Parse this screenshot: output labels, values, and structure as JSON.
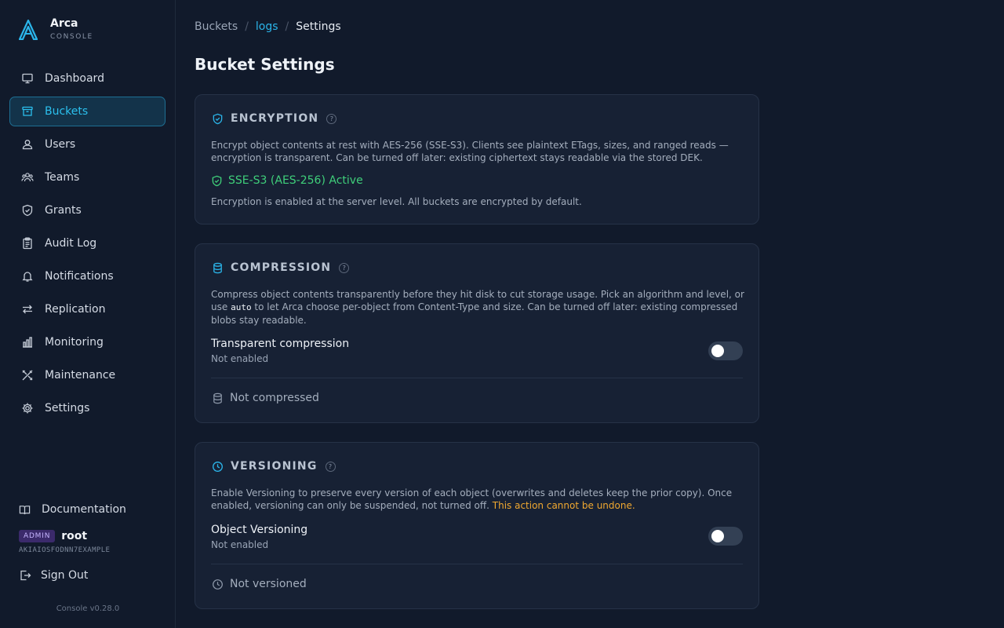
{
  "brand": {
    "name": "Arca",
    "subtitle": "CONSOLE"
  },
  "nav": [
    {
      "label": "Dashboard",
      "icon": "monitor-icon",
      "active": false
    },
    {
      "label": "Buckets",
      "icon": "archive-box-icon",
      "active": true
    },
    {
      "label": "Users",
      "icon": "user-icon",
      "active": false
    },
    {
      "label": "Teams",
      "icon": "users-icon",
      "active": false
    },
    {
      "label": "Grants",
      "icon": "shield-icon",
      "active": false
    },
    {
      "label": "Audit Log",
      "icon": "clipboard-icon",
      "active": false
    },
    {
      "label": "Notifications",
      "icon": "bell-icon",
      "active": false
    },
    {
      "label": "Replication",
      "icon": "arrows-icon",
      "active": false
    },
    {
      "label": "Monitoring",
      "icon": "bar-chart-icon",
      "active": false
    },
    {
      "label": "Maintenance",
      "icon": "tools-icon",
      "active": false
    },
    {
      "label": "Settings",
      "icon": "gear-icon",
      "active": false
    }
  ],
  "sidebar_footer": {
    "documentation": "Documentation",
    "role_badge": "ADMIN",
    "username": "root",
    "access_key": "AKIAIOSFODNN7EXAMPLE",
    "sign_out": "Sign Out",
    "version": "Console v0.28.0"
  },
  "breadcrumb": {
    "root": "Buckets",
    "bucket": "logs",
    "current": "Settings",
    "separator": "/"
  },
  "page_title": "Bucket Settings",
  "encryption": {
    "title": "ENCRYPTION",
    "description": "Encrypt object contents at rest with AES-256 (SSE-S3). Clients see plaintext ETags, sizes, and ranged reads — encryption is transparent. Can be turned off later: existing ciphertext stays readable via the stored DEK.",
    "status": "SSE-S3 (AES-256) Active",
    "note": "Encryption is enabled at the server level. All buckets are encrypted by default."
  },
  "compression": {
    "title": "COMPRESSION",
    "description_before": "Compress object contents transparently before they hit disk to cut storage usage. Pick an algorithm and level, or use",
    "description_code": "auto",
    "description_after": "to let Arca choose per-object from Content-Type and size. Can be turned off later: existing compressed blobs stay readable.",
    "setting_title": "Transparent compression",
    "setting_status": "Not enabled",
    "enabled": false,
    "state": "Not compressed"
  },
  "versioning": {
    "title": "VERSIONING",
    "description": "Enable Versioning to preserve every version of each object (overwrites and deletes keep the prior copy). Once enabled, versioning can only be suspended, not turned off.",
    "warning": "This action cannot be undone.",
    "setting_title": "Object Versioning",
    "setting_status": "Not enabled",
    "enabled": false,
    "state": "Not versioned"
  },
  "colors": {
    "accent": "#2bb5ea",
    "success": "#3fcf7a",
    "warning": "#f0a830",
    "background": "#111a2b",
    "card": "#172134"
  }
}
